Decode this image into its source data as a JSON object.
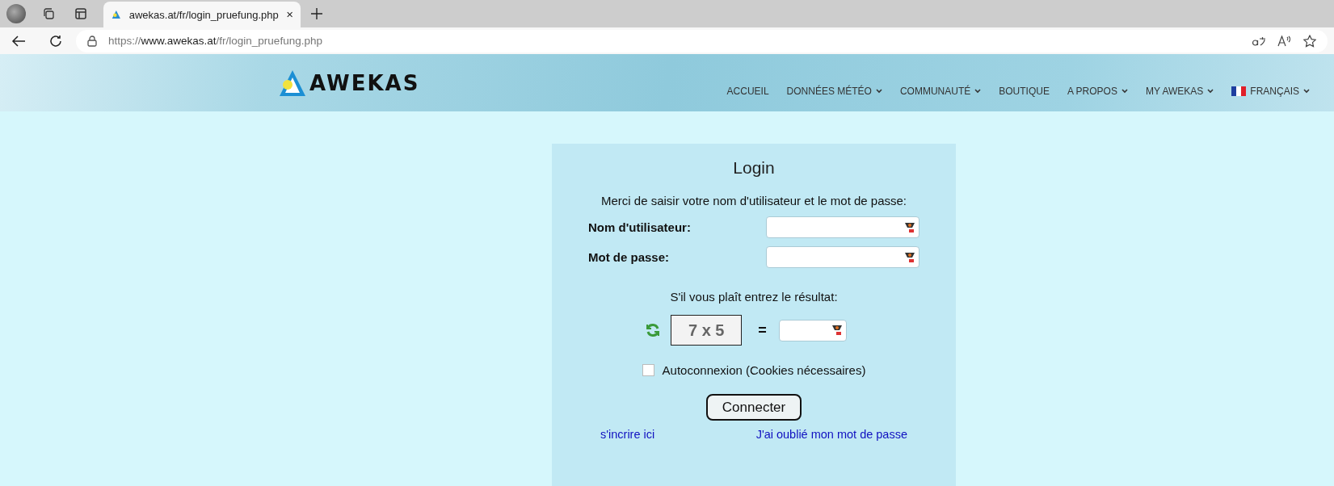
{
  "browser": {
    "tab": {
      "title": "awekas.at/fr/login_pruefung.php",
      "selected": true
    },
    "url": {
      "scheme": "https://",
      "host": "www.awekas.at",
      "path": "/fr/login_pruefung.php"
    }
  },
  "header": {
    "logo": "AWEKAS",
    "nav": [
      {
        "label": "ACCUEIL",
        "kind": "plain"
      },
      {
        "label": "DONNÉES MÉTÉO",
        "kind": "menu"
      },
      {
        "label": "COMMUNAUTÉ",
        "kind": "menu"
      },
      {
        "label": "BOUTIQUE",
        "kind": "plain"
      },
      {
        "label": "A PROPOS",
        "kind": "menu"
      },
      {
        "label": "MY AWEKAS",
        "kind": "menu"
      },
      {
        "label": "FRANÇAIS",
        "kind": "language"
      }
    ]
  },
  "login": {
    "title": "Login",
    "intro": "Merci de saisir votre nom d'utilisateur et le mot de passe:",
    "fields": [
      {
        "label": "Nom d'utilisateur:"
      },
      {
        "label": "Mot de passe:"
      }
    ],
    "captcha": {
      "prompt": "S'il vous plaît entrez le résultat:",
      "question": "7 x 5",
      "equals": "="
    },
    "remember": {
      "label": "Autoconnexion (Cookies nécessaires)",
      "checked": false
    },
    "submit": "Connecter",
    "links": [
      "s'incrire ici",
      "J'ai oublié mon mot de passe"
    ]
  }
}
